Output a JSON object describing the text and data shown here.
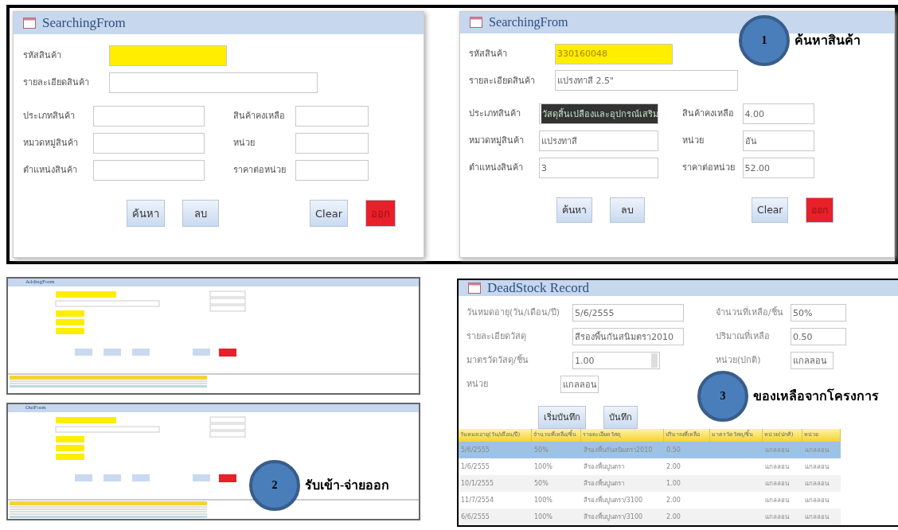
{
  "search_forms": [
    {
      "title": "SearchingFrom",
      "code": {
        "label": "รหัสสินค้า"
      },
      "detail": {
        "label": "รายละเอียดสินค้า"
      },
      "left_fields": [
        {
          "label": "ประเภทสินค้า",
          "highlighted": false
        },
        {
          "label": "หมวดหมู่สินค้า",
          "highlighted": false
        },
        {
          "label": "ตำแหน่งสินค้า",
          "highlighted": false
        }
      ],
      "right_fields": [
        {
          "label": "สินค้าคงเหลือ"
        },
        {
          "label": "หน่วย"
        },
        {
          "label": "ราคาต่อหน่วย"
        }
      ],
      "buttons": [
        {
          "label": "ค้นหา",
          "kind": "normal"
        },
        {
          "label": "ลบ",
          "kind": "normal"
        },
        {
          "label": "Clear",
          "kind": "normal"
        },
        {
          "label": "ออก",
          "kind": "exit"
        }
      ]
    },
    {
      "title": "SearchingFrom",
      "code": {
        "label": "รหัสสินค้า",
        "value": "330160048"
      },
      "detail": {
        "label": "รายละเอียดสินค้า",
        "value": "แปรงทาสี 2.5\""
      },
      "left_fields": [
        {
          "label": "ประเภทสินค้า",
          "value": "วัสดุสิ้นเปลืองและอุปกรณ์เสริม",
          "highlighted": true
        },
        {
          "label": "หมวดหมู่สินค้า",
          "value": "แปรงทาสี",
          "highlighted": false
        },
        {
          "label": "ตำแหน่งสินค้า",
          "value": "3",
          "highlighted": false
        }
      ],
      "right_fields": [
        {
          "label": "สินค้าคงเหลือ",
          "value": "4.00"
        },
        {
          "label": "หน่วย",
          "value": "อัน"
        },
        {
          "label": "ราคาต่อหน่วย",
          "value": "52.00"
        }
      ],
      "buttons": [
        {
          "label": "ค้นหา",
          "kind": "normal"
        },
        {
          "label": "ลบ",
          "kind": "normal"
        },
        {
          "label": "Clear",
          "kind": "normal"
        },
        {
          "label": "ออก",
          "kind": "exit"
        }
      ],
      "callout": {
        "number": "1",
        "label": "ค้นหาสินค้า"
      }
    }
  ],
  "thumbnails": [
    {
      "title": "AddingForm"
    },
    {
      "title": "OutForm"
    }
  ],
  "thumbnail_callout": {
    "number": "2",
    "label": "รับเข้า-จ่ายออก"
  },
  "deadstock": {
    "title": "DeadStock Record",
    "left_fields": [
      {
        "label": "วันหมดอายุ(วัน/เดือน/ปี)",
        "value": "5/6/2555",
        "kind": "text"
      },
      {
        "label": "รายละเอียดวัสดุ",
        "value": "สีรองพื้นกันสนิมตรา2010",
        "kind": "text"
      },
      {
        "label": "มาตรวัดวัสดุ/ชิ้น",
        "value": "1.00",
        "kind": "dropdown"
      },
      {
        "label": "หน่วย",
        "value": "แกลลอน",
        "kind": "short"
      }
    ],
    "right_fields": [
      {
        "label": "จำนวนที่เหลือ/ชิ้น",
        "value": "50%",
        "kind": "text"
      },
      {
        "label": "ปริมาณที่เหลือ",
        "value": "0.50",
        "kind": "text"
      },
      {
        "label": "หน่วย(ปกติ)",
        "value": "แกลลอน",
        "kind": "short"
      }
    ],
    "buttons": [
      "เริ่มบันทึก",
      "บันทึก"
    ],
    "table": {
      "columns": [
        "วันหมดอายุ(วัน/เดือน/ปี)",
        "จำนวนที่เหลือ/ชิ้น",
        "รายละเอียดวัสดุ",
        "ปริมาณที่เหลือ",
        "มาตรวัดวัสดุ/ชิ้น",
        "หน่วย(ปกติ)",
        "หน่วย"
      ],
      "rows": [
        {
          "selected": true,
          "cells": [
            "5/6/2555",
            "50%",
            "สีรองพื้นกันสนิมตรา2010",
            "0.50",
            null,
            "แกลลอน",
            "แกลลอน"
          ]
        },
        {
          "selected": false,
          "cells": [
            "1/6/2555",
            "100%",
            "สีรองพื้นปูนตรา",
            "2.00",
            null,
            "แกลลอน",
            "แกลลอน"
          ]
        },
        {
          "selected": false,
          "cells": [
            "10/1/2555",
            "50%",
            "สีรองพื้นปูนตรา",
            "1.00",
            null,
            "แกลลอน",
            "แกลลอน"
          ]
        },
        {
          "selected": false,
          "cells": [
            "11/7/2554",
            "100%",
            "สีรองพื้นปูนตรา/3100",
            "2.00",
            null,
            "แกลลอน",
            "แกลลอน"
          ]
        },
        {
          "selected": false,
          "cells": [
            "6/6/2555",
            "100%",
            "สีรองพื้นปูนตรา/3100",
            "2.00",
            null,
            "แกลลอน",
            "แกลลอน"
          ]
        }
      ]
    },
    "callout": {
      "number": "3",
      "label": "ของเหลือจากโครงการ"
    }
  }
}
